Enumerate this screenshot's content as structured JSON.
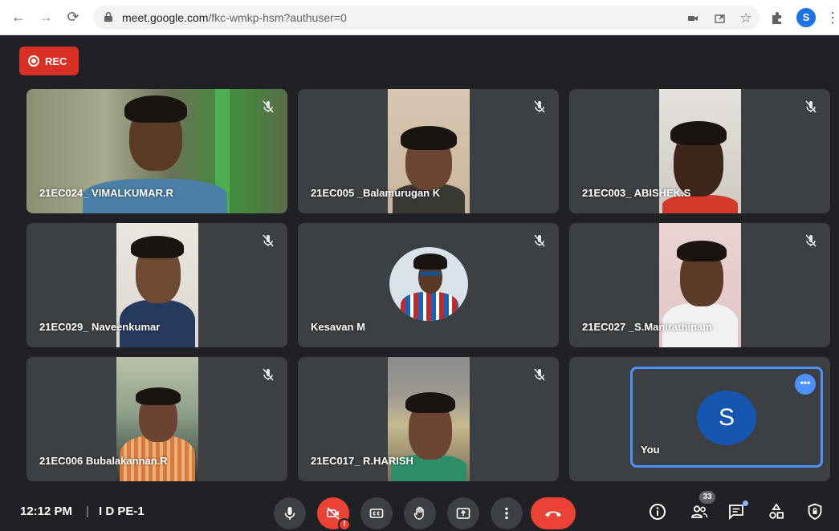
{
  "browser": {
    "url_host": "meet.google.com",
    "url_path": "/fkc-wmkp-hsm?authuser=0",
    "profile_initial": "S"
  },
  "meet": {
    "rec_label": "REC",
    "participants": [
      {
        "name": "21EC024_ VIMALKUMAR.R",
        "muted": true
      },
      {
        "name": "21EC005 _Balamurugan K",
        "muted": true
      },
      {
        "name": "21EC003_ ABISHEK.S",
        "muted": true
      },
      {
        "name": "21EC029_ Naveenkumar",
        "muted": true
      },
      {
        "name": "Kesavan M",
        "muted": true
      },
      {
        "name": "21EC027 _S.Manirathinam",
        "muted": true
      },
      {
        "name": "21EC006 Bubalakannan.R",
        "muted": true
      },
      {
        "name": "21EC017_ R.HARISH",
        "muted": true
      }
    ],
    "self": {
      "name": "You",
      "initial": "S"
    },
    "bottom_bar": {
      "time": "12:12 PM",
      "separator": "|",
      "meeting_name": "I D PE-1",
      "camera_alert": "!",
      "people_count": "33",
      "more_options": "•••"
    }
  },
  "colors": {
    "background": "#202124",
    "tile": "#3c4043",
    "rec_red": "#d93025",
    "end_call_red": "#ea4335",
    "self_border": "#4d90fe",
    "self_avatar": "#1557b0"
  }
}
